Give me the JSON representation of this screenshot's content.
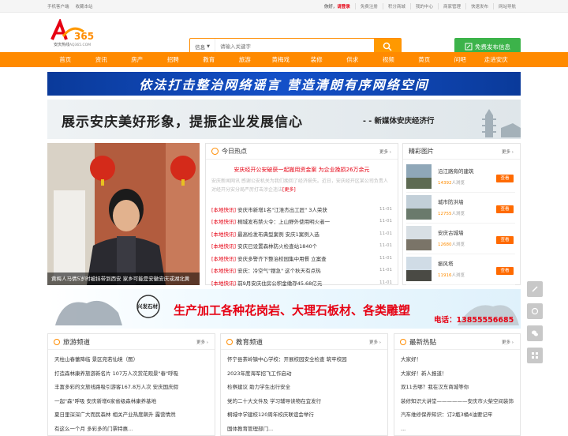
{
  "topbar": {
    "mobile": "手机客户端",
    "bookmark": "收藏本站",
    "greeting": "你好，",
    "login": "请登录",
    "register": "免费注册",
    "points": "积分商城",
    "my_center": "我的中心",
    "merchant": "商家管理",
    "quick_post": "快速发布",
    "nav": "网站导航"
  },
  "logo": {
    "brand": "安庆热线",
    "number": "365",
    "domain": "AQ365.COM"
  },
  "search": {
    "category": "信息",
    "placeholder": "请输入关键字"
  },
  "post_button": "免费发布信息",
  "nav": [
    "首页",
    "资讯",
    "房产",
    "招聘",
    "教育",
    "旅游",
    "黄梅戏",
    "装修",
    "供求",
    "视频",
    "黄页",
    "问吧",
    "走进安庆"
  ],
  "banner1": "依法打击整治网络谣言    营造清朗有序网络空间",
  "banner2": {
    "title": "展示安庆美好形象，提振企业发展信心",
    "sub": "- - 新媒体安庆经济行"
  },
  "slider": {
    "caption": "黄梅人马倩5岁时被拐带到西安 家乡可能是安徽安庆或湖北黄"
  },
  "hot": {
    "title": "今日热点",
    "more": "更多",
    "headline": "安庆经开公安破获一起搬用资金案 为企业挽损26万余元",
    "summary": "安庆新闻网讯 感谢公安机关为我们挽回了经济损失。近日，安庆经开区某公司负责人对经开分安分局严厉打击涉企违法",
    "summary_more": "[更多]",
    "items": [
      {
        "tag": "[本地快讯]",
        "text": "安庆市新增1名\"江淮杰出工匠\" 3人荣获",
        "date": "11-01"
      },
      {
        "tag": "[本地快讯]",
        "text": "桐城发布禁火令：上山野外使用明火者一",
        "date": "11-01"
      },
      {
        "tag": "[本地快讯]",
        "text": "最高检发布典型案例 安庆1案例入选",
        "date": "11-01"
      },
      {
        "tag": "[本地快讯]",
        "text": "安庆已设置森林防火检查站1840个",
        "date": "11-01"
      },
      {
        "tag": "[本地快讯]",
        "text": "安庆多警齐下整治校园集中用餐 立案查",
        "date": "11-01"
      },
      {
        "tag": "[本地快讯]",
        "text": "安庆：冷空气\"摆急\" 这个秋天有点热",
        "date": "11-01"
      },
      {
        "tag": "[本地快讯]",
        "text": "前9月安庆住房公积金缴存45.68亿元",
        "date": "11-01"
      }
    ]
  },
  "pics": {
    "title": "精彩图片",
    "more": "更多",
    "go": "查看",
    "suffix": "人浏览",
    "items": [
      {
        "name": "沿江路旁的建筑",
        "views": "14392"
      },
      {
        "name": "城市防洪墙",
        "views": "12755"
      },
      {
        "name": "安庆古城墙",
        "views": "12680"
      },
      {
        "name": "振风塔",
        "views": "11916"
      }
    ]
  },
  "banner3": {
    "brand": "兴发石材",
    "title": "生产加工各种花岗岩、大理石板材、各类雕塑",
    "phone": "电话：13855556685"
  },
  "travel": {
    "title": "旅游频道",
    "more": "更多",
    "items": [
      "天柱山春蕾降临 景区宛若仙境（图）",
      "打造森林康养旅游新名片 107万人次赏花观景\"春\"呼吸",
      "丰富多彩的文旅线路吸引游客167.8万人次 安庆国庆假",
      "一起\"森\"呼吸 安庆新增6家省级森林康养基地",
      "夏日里深深广大而民森林 相关产业热度飙升 露营情然",
      "有这么一个月 多彩多的门票特惠..."
    ]
  },
  "edu": {
    "title": "教育频道",
    "more": "更多",
    "items": [
      "怀宁县茶岭镇中心学校：开展校园安全检查 筑牢校园",
      "2023年度海军招飞工作启动",
      "检察建议 助力学生出行安全",
      "党的二十大文件及 学习辅导读物在宜发行",
      "桐城中学建校120周年校庆联谊会举行",
      "国体教育管理部门..."
    ]
  },
  "latest": {
    "title": "最新热贴",
    "more": "更多",
    "items": [
      "大家好！",
      "大家好！新人报道！",
      "双11去哪？我在汉东商城等你",
      "装修知识大讲堂——————安庆市火柴空间装饰",
      "汽车维修保养知识：订2瓶3桶4油要记牢",
      "..."
    ]
  }
}
